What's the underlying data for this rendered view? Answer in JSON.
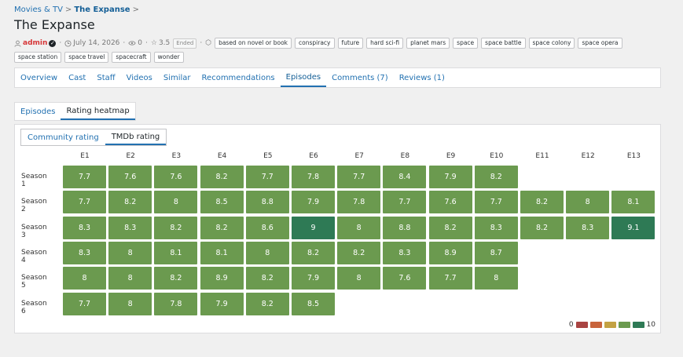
{
  "breadcrumb": {
    "parent": "Movies & TV",
    "current": "The Expanse",
    "sep": ">"
  },
  "page_title": "The Expanse",
  "meta": {
    "author": "admin",
    "date": "July 14, 2026",
    "views": "0",
    "stars": "3.5",
    "status": "Ended",
    "tags": [
      "based on novel or book",
      "conspiracy",
      "future",
      "hard sci-fi",
      "planet mars",
      "space",
      "space battle",
      "space colony",
      "space opera",
      "space station",
      "space travel",
      "spacecraft",
      "wonder"
    ]
  },
  "tabs": [
    "Overview",
    "Cast",
    "Staff",
    "Videos",
    "Similar",
    "Recommendations",
    "Episodes",
    "Comments (7)",
    "Reviews (1)"
  ],
  "active_tab": 6,
  "subtabs": [
    "Episodes",
    "Rating heatmap"
  ],
  "active_subtab": 1,
  "source_tabs": [
    "Community rating",
    "TMDb rating"
  ],
  "active_source": 1,
  "colors": {
    "accent": "#2271b1",
    "low": "#a94442",
    "mid_low": "#c8643c",
    "mid": "#c3a243",
    "high": "#6b9a4f",
    "top": "#2e7a55"
  },
  "legend": {
    "min": "0",
    "max": "10"
  },
  "chart_data": {
    "type": "heatmap",
    "x": [
      "E1",
      "E2",
      "E3",
      "E4",
      "E5",
      "E6",
      "E7",
      "E8",
      "E9",
      "E10",
      "E11",
      "E12",
      "E13"
    ],
    "y": [
      "Season 1",
      "Season 2",
      "Season 3",
      "Season 4",
      "Season 5",
      "Season 6"
    ],
    "values": [
      [
        7.7,
        7.6,
        7.6,
        8.2,
        7.7,
        7.8,
        7.7,
        8.4,
        7.9,
        8.2,
        null,
        null,
        null
      ],
      [
        7.7,
        8.2,
        8,
        8.5,
        8.8,
        7.9,
        7.8,
        7.7,
        7.6,
        7.7,
        8.2,
        8,
        8.1
      ],
      [
        8.3,
        8.3,
        8.2,
        8.2,
        8.6,
        9,
        8,
        8.8,
        8.2,
        8.3,
        8.2,
        8.3,
        9.1
      ],
      [
        8.3,
        8,
        8.1,
        8.1,
        8,
        8.2,
        8.2,
        8.3,
        8.9,
        8.7,
        null,
        null,
        null
      ],
      [
        8,
        8,
        8.2,
        8.9,
        8.2,
        7.9,
        8,
        7.6,
        7.7,
        8,
        null,
        null,
        null
      ],
      [
        7.7,
        8,
        7.8,
        7.9,
        8.2,
        8.5,
        null,
        null,
        null,
        null,
        null,
        null,
        null
      ]
    ],
    "range": [
      0,
      10
    ]
  }
}
